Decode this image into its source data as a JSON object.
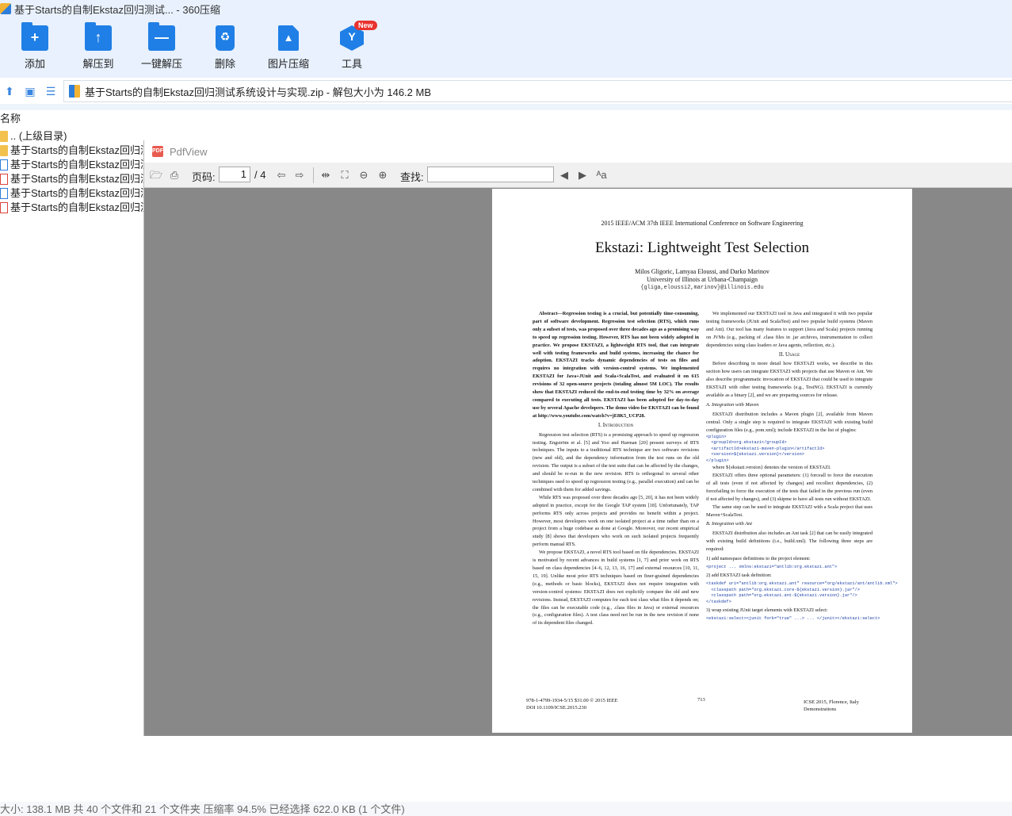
{
  "window": {
    "title": "基于Starts的自制Ekstaz回归测试... - 360压缩"
  },
  "toolbar": {
    "items": [
      {
        "label": "添加",
        "glyph": "+"
      },
      {
        "label": "解压到",
        "glyph": "↑"
      },
      {
        "label": "一键解压",
        "glyph": "—"
      },
      {
        "label": "删除",
        "glyph": "♻"
      },
      {
        "label": "图片压缩",
        "glyph": "▲"
      },
      {
        "label": "工具",
        "glyph": "Y"
      }
    ],
    "new_badge": "New"
  },
  "address": {
    "path": "基于Starts的自制Ekstaz回归测试系统设计与实现.zip - 解包大小为 146.2 MB"
  },
  "list": {
    "column_name": "名称",
    "rows": [
      {
        "name": ".. (上级目录)",
        "type": "folder"
      },
      {
        "name": "基于Starts的自制Ekstaz回归测试",
        "type": "folder"
      },
      {
        "name": "基于Starts的自制Ekstaz回归测试",
        "type": "doc"
      },
      {
        "name": "基于Starts的自制Ekstaz回归测试",
        "type": "pdf"
      },
      {
        "name": "基于Starts的自制Ekstaz回归测试",
        "type": "doc"
      },
      {
        "name": "基于Starts的自制Ekstaz回归测试",
        "type": "pdf"
      }
    ]
  },
  "pdfview": {
    "title": "PdfView",
    "page_label": "页码:",
    "page_current": "1",
    "page_total": "/ 4",
    "find_label": "查找:",
    "doc": {
      "conference": "2015 IEEE/ACM 37th IEEE International Conference on Software Engineering",
      "title": "Ekstazi: Lightweight Test Selection",
      "authors": "Milos Gligoric, Lamyaa Eloussi, and Darko Marinov",
      "affiliation": "University of Illinois at Urbana-Champaign",
      "emails": "{gliga,eloussi2,marinov}@illinois.edu",
      "abstract": "Abstract—Regression testing is a crucial, but potentially time-consuming, part of software development. Regression test selection (RTS), which runs only a subset of tests, was proposed over three decades ago as a promising way to speed up regression testing. However, RTS has not been widely adopted in practice. We propose EKSTAZI, a lightweight RTS tool, that can integrate well with testing frameworks and build systems, increasing the chance for adoption. EKSTAZI tracks dynamic dependencies of tests on files and requires no integration with version-control systems. We implemented EKSTAZI for Java+JUnit and Scala+ScalaTest, and evaluated it on 615 revisions of 32 open-source projects (totaling almost 5M LOC). The results show that EKSTAZI reduced the end-to-end testing time by 32% on average compared to executing all tests. EKSTAZI has been adopted for day-to-day use by several Apache developers. The demo video for EKSTAZI can be found at http://www.youtube.com/watch?v=jE8K5_UCP28.",
      "sec1": "I. Introduction",
      "sec1_p1": "Regression test selection (RTS) is a promising approach to speed up regression testing. Engström et al. [5] and Yoo and Harman [20] present surveys of RTS techniques. The inputs to a traditional RTS technique are two software revisions (new and old), and the dependency information from the test runs on the old revision. The output is a subset of the test suite that can be affected by the changes, and should be re-run in the new revision. RTS is orthogonal to several other techniques used to speed up regression testing (e.g., parallel execution) and can be combined with them for added savings.",
      "sec1_p2": "While RTS was proposed over three decades ago [5, 20], it has not been widely adopted in practice, except for the Google TAP system [18]. Unfortunately, TAP performs RTS only across projects and provides no benefit within a project. However, most developers work on one isolated project at a time rather than on a project from a huge codebase as done at Google. Moreover, our recent empirical study [8] shows that developers who work on such isolated projects frequently perform manual RTS.",
      "sec1_p3": "We propose EKSTAZI, a novel RTS tool based on file dependencies. EKSTAZI is motivated by recent advances in build systems [1, 7] and prior work on RTS based on class dependencies [4–6, 12, 13, 16, 17] and external resources [10, 11, 15, 19]. Unlike most prior RTS techniques based on finer-grained dependencies (e.g., methods or basic blocks), EKSTAZI does not require integration with version-control systems: EKSTAZI does not explicitly compare the old and new revisions. Instead, EKSTAZI computes for each test class what files it depends on; the files can be executable code (e.g., .class files in Java) or external resources (e.g., configuration files). A test class need not be run in the new revision if none of its dependent files changed.",
      "r_p1": "We implemented our EKSTAZI tool in Java and integrated it with two popular testing frameworks (JUnit and ScalaTest) and two popular build systems (Maven and Ant). Our tool has many features to support (Java and Scala) projects running on JVMs (e.g., packing of .class files in .jar archives, instrumentation to collect dependencies using class loaders or Java agents, reflection, etc.).",
      "sec2": "II. Usage",
      "r_p2": "Before describing in more detail how EKSTAZI works, we describe in this section how users can integrate EKSTAZI with projects that use Maven or Ant. We also describe programmatic invocation of EKSTAZI that could be used to integrate EKSTAZI with other testing frameworks (e.g., TestNG). EKSTAZI is currently available as a binary [2], and we are preparing sources for release.",
      "secA": "A. Integration with Maven",
      "r_p3": "EKSTAZI distribution includes a Maven plugin [2], available from Maven central. Only a single step is required to integrate EKSTAZI with existing build configuration files (e.g., pom.xml); include EKSTAZI in the list of plugins:",
      "code1": "<plugin>\n  <groupId>org.ekstazi</groupId>\n  <artifactId>ekstazi-maven-plugin</artifactId>\n  <version>${ekstazi.version}</version>\n</plugin>",
      "r_p4": "where ${ekstazi.version} denotes the version of EKSTAZI.",
      "r_p5": "EKSTAZI offers three optional parameters: (1) forceall to force the execution of all tests (even if not affected by changes) and recollect dependencies, (2) forcefailing to force the execution of the tests that failed in the previous run (even if not affected by changes), and (3) skipme to have all tests run without EKSTAZI.",
      "r_p6": "The same step can be used to integrate EKSTAZI with a Scala project that uses Maven+ScalaTest.",
      "secB": "B. Integration with Ant",
      "r_p7": "EKSTAZI distribution also includes an Ant task [2] that can be easily integrated with existing build definitions (i.e., build.xml). The following three steps are required:",
      "r_s1": "1) add namespace definitions to the project element:",
      "code2": "<project ... xmlns:ekstazi=\"antlib:org.ekstazi.ant\">",
      "r_s2": "2) add EKSTAZI task definition:",
      "code3": "<taskdef uri=\"antlib:org.ekstazi.ant\" resource=\"org/ekstazi/ant/antlib.xml\">\n  <classpath path=\"org.ekstazi.core-${ekstazi.version}.jar\"/>\n  <classpath path=\"org.ekstazi.ant-${ekstazi.version}.jar\"/>\n</taskdef>",
      "r_s3": "3) wrap existing JUnit target elements with EKSTAZI select:",
      "code4": "<ekstazi:select><junit fork=\"true\" ...> ... </junit></ekstazi:select>",
      "foot_left": "978-1-4799-1934-5/15 $31.00 © 2015 IEEE\nDOI 10.1109/ICSE.2015.230",
      "foot_mid": "713",
      "foot_right": "ICSE 2015, Florence, Italy\nDemonstrations"
    }
  },
  "status": {
    "text": "大小: 138.1 MB 共 40 个文件和 21 个文件夹 压缩率 94.5% 已经选择 622.0 KB (1 个文件)"
  }
}
